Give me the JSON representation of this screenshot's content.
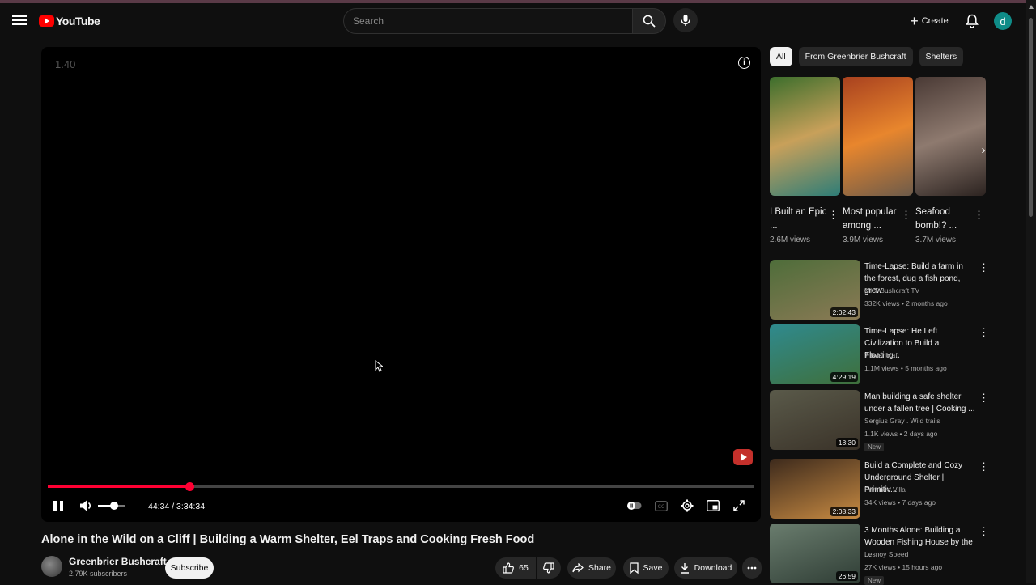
{
  "header": {
    "logo_text": "YouTube",
    "search_placeholder": "Search",
    "create_label": "Create",
    "avatar_letter": "d"
  },
  "player": {
    "speed_overlay": "1.40",
    "progress_fraction": 0.2,
    "volume_fraction": 0.6,
    "time_display": "44:34 / 3:34:34"
  },
  "video": {
    "title": "Alone in the Wild on a Cliff | Building a Warm Shelter, Eel Traps and Cooking Fresh Food",
    "channel_name": "Greenbrier Bushcraft",
    "subscribers": "2.79K subscribers",
    "subscribe_label": "Subscribe",
    "like_count": "65",
    "share_label": "Share",
    "save_label": "Save",
    "download_label": "Download"
  },
  "chips": [
    "All",
    "From Greenbrier Bushcraft",
    "Shelters"
  ],
  "shorts": [
    {
      "title": "I Built an Epic ...",
      "views": "2.6M views",
      "thumb_colors": [
        "#3c6e2c",
        "#c8a05a",
        "#2e7d77"
      ]
    },
    {
      "title": "Most popular among ...",
      "views": "3.9M views",
      "thumb_colors": [
        "#a8411f",
        "#e8862d",
        "#6d5b4a"
      ]
    },
    {
      "title": "Seafood bomb!? ...",
      "views": "3.7M views",
      "thumb_colors": [
        "#4a3a35",
        "#8e7a6f",
        "#2c2320"
      ]
    }
  ],
  "recommendations": [
    {
      "title": "Time-Lapse: Build a farm in the forest, dug a fish pond, grew ...",
      "channel": "Mr.T Bushcraft TV",
      "meta": "332K views • 2 months ago",
      "duration": "2:02:43",
      "badge": "",
      "thumb_colors": [
        "#4e6d3a",
        "#8b7a55"
      ]
    },
    {
      "title": "Time-Lapse: He Left Civilization to Build a Floating...",
      "channel": "7 Bushcraft",
      "meta": "1.1M views • 5 months ago",
      "duration": "4:29:19",
      "badge": "",
      "thumb_colors": [
        "#2f8a8e",
        "#3f6f3a"
      ]
    },
    {
      "title": "Man building a safe shelter under a fallen tree | Cooking ...",
      "channel": "Sergius Gray . Wild trails",
      "meta": "1.1K views • 2 days ago",
      "duration": "18:30",
      "badge": "New",
      "thumb_colors": [
        "#5a5a4a",
        "#3a3228"
      ]
    },
    {
      "title": "Build a Complete and Cozy Underground Shelter | Primitiv...",
      "channel": "Primitive Villa",
      "meta": "34K views • 7 days ago",
      "duration": "2:08:33",
      "badge": "",
      "thumb_colors": [
        "#3d2a1c",
        "#c78a42"
      ]
    },
    {
      "title": "3 Months Alone: Building a Wooden Fishing House by the ...",
      "channel": "Lesnoy Speed",
      "meta": "27K views • 15 hours ago",
      "duration": "26:59",
      "badge": "New",
      "thumb_colors": [
        "#6a7d6e",
        "#2f3d35"
      ]
    }
  ]
}
